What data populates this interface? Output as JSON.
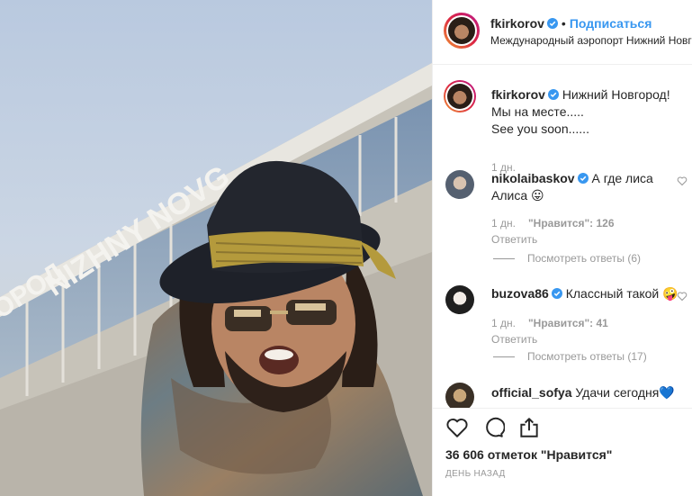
{
  "post": {
    "author": "fkirkorov",
    "follow_label": "Подписаться",
    "location": "Международный аэропорт Нижний Новг",
    "photo_sign": "NIZHNY NOVG",
    "photo_sign2": "ОРОД",
    "caption_line1": "Нижний Новгород!",
    "caption_line2": "Мы на месте.....",
    "caption_line3": "See you soon......",
    "caption_time": "1 дн.",
    "likes": "36 606 отметок \"Нравится\"",
    "posted": "ДЕНЬ НАЗАД"
  },
  "comments": [
    {
      "user": "nikolaibaskov",
      "text_line1": "А где лиса",
      "text_line2": "Алиса",
      "emoji": "😛",
      "time": "1 дн.",
      "likes": "\"Нравится\": 126",
      "reply": "Ответить",
      "view_replies": "Посмотреть ответы (6)"
    },
    {
      "user": "buzova86",
      "text_line1": "Классный такой",
      "emoji": "🤪",
      "time": "1 дн.",
      "likes": "\"Нравится\": 41",
      "reply": "Ответить",
      "view_replies": "Посмотреть ответы (17)"
    },
    {
      "user": "official_sofya",
      "text_line1": "Удачи сегодня",
      "emoji": "💙"
    }
  ],
  "icons": {
    "verified": "verified-badge-icon",
    "like": "heart-icon",
    "comment": "comment-bubble-icon",
    "share": "share-icon"
  },
  "colors": {
    "link": "#3897f0",
    "muted": "#999999",
    "text": "#262626"
  }
}
